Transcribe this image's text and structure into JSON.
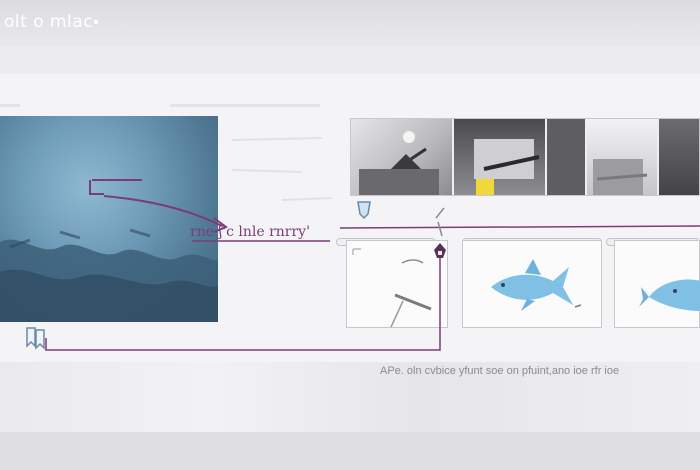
{
  "window": {
    "title": "olt o mlac"
  },
  "annotations": {
    "top_caption": "rne ʃ'c lnle rnrry'",
    "bottom_caption": "APe. oln cvbice yfunt soe on pfuint,ano ioe rfr ioe"
  },
  "colors": {
    "annotation": "#7b3d79",
    "water": "#6f9cb8",
    "fish": "#7fc0e4",
    "highlight": "#f0d83a"
  },
  "icons": {
    "left_marker": "bookmark-icon",
    "center_marker": "tag-icon",
    "pin": "pin-icon"
  }
}
